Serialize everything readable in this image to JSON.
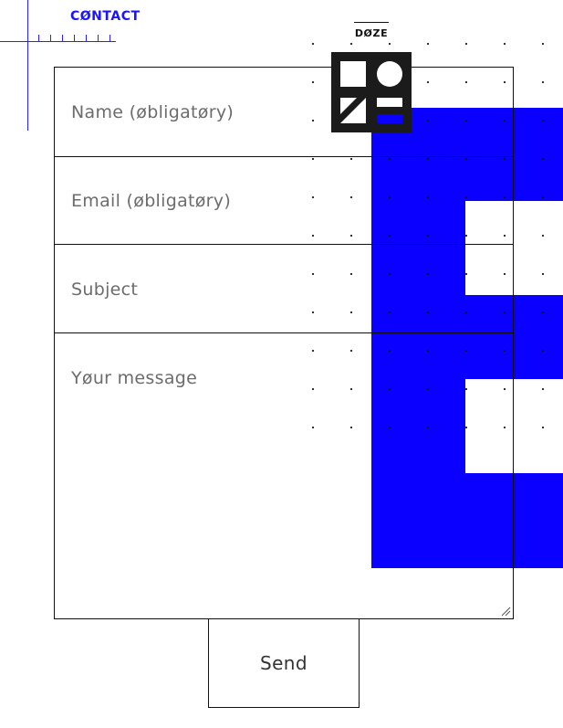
{
  "header": {
    "section_title": "CØNTACT",
    "brand_name": "DØZE"
  },
  "form": {
    "name_placeholder": "Name (øbligatøry)",
    "email_placeholder": "Email (øbligatøry)",
    "subject_placeholder": "Subject",
    "message_placeholder": "Yøur message",
    "send_label": "Send"
  },
  "colors": {
    "accent": "#0a00ff",
    "logo_bg": "#1b1b1b",
    "text_muted": "#6c6c6c"
  }
}
